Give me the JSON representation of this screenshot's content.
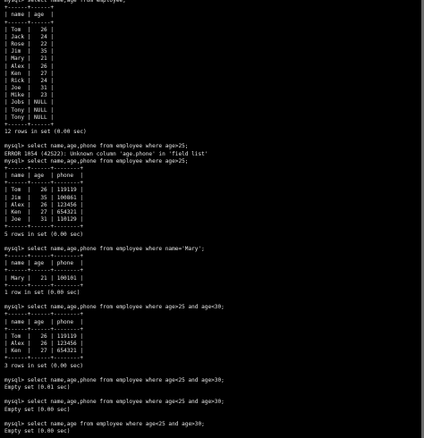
{
  "terminal": {
    "lines": [
      "mysql> select name,age from employee;",
      "+------+------+",
      "| name | age  |",
      "+------+------+",
      "| Tom  |   26 |",
      "| Jack |   24 |",
      "| Rose |   22 |",
      "| Jim  |   35 |",
      "| Mary |   21 |",
      "| Alex |   26 |",
      "| Ken  |   27 |",
      "| Rick |   24 |",
      "| Joe  |   31 |",
      "| Mike |   23 |",
      "| Jobs | NULL |",
      "| Tony | NULL |",
      "| Tony | NULL |",
      "+------+------+",
      "12 rows in set (0.00 sec)",
      "",
      "mysql> select name,age,phone from employee where age>25;",
      "ERROR 1054 (42S22): Unknown column 'age.phone' in 'field list'",
      "mysql> select name,age,phone from employee where age>25;",
      "+------+------+--------+",
      "| name | age  | phone  |",
      "+------+------+--------+",
      "| Tom  |   26 | 119119 |",
      "| Jim  |   35 | 100861 |",
      "| Alex |   26 | 123456 |",
      "| Ken  |   27 | 654321 |",
      "| Joe  |   31 | 110129 |",
      "+------+------+--------+",
      "5 rows in set (0.00 sec)",
      "",
      "mysql> select name,age,phone from employee where name='Mary';",
      "+------+------+--------+",
      "| name | age  | phone  |",
      "+------+------+--------+",
      "| Mary |   21 | 100101 |",
      "+------+------+--------+",
      "1 row in set (0.00 sec)",
      "",
      "mysql> select name,age,phone from employee where age>25 and age<30;",
      "+------+------+--------+",
      "| name | age  | phone  |",
      "+------+------+--------+",
      "| Tom  |   26 | 119119 |",
      "| Alex |   26 | 123456 |",
      "| Ken  |   27 | 654321 |",
      "+------+------+--------+",
      "3 rows in set (0.00 sec)",
      "",
      "mysql> select name,age,phone from employee where age<25 and age>30;",
      "Empty set (0.01 sec)",
      "",
      "mysql> select name,age,phone from employee where age<25 and age>30;",
      "Empty set (0.00 sec)",
      "",
      "mysql> select name,age from employee where age<25 and age>30;",
      "Empty set (0.00 sec)"
    ]
  },
  "colors": {
    "background": "#000000",
    "text": "#e6e6e6",
    "scrollbar_track": "#1a1a1a",
    "scrollbar_thumb": "#6b6b6b"
  }
}
